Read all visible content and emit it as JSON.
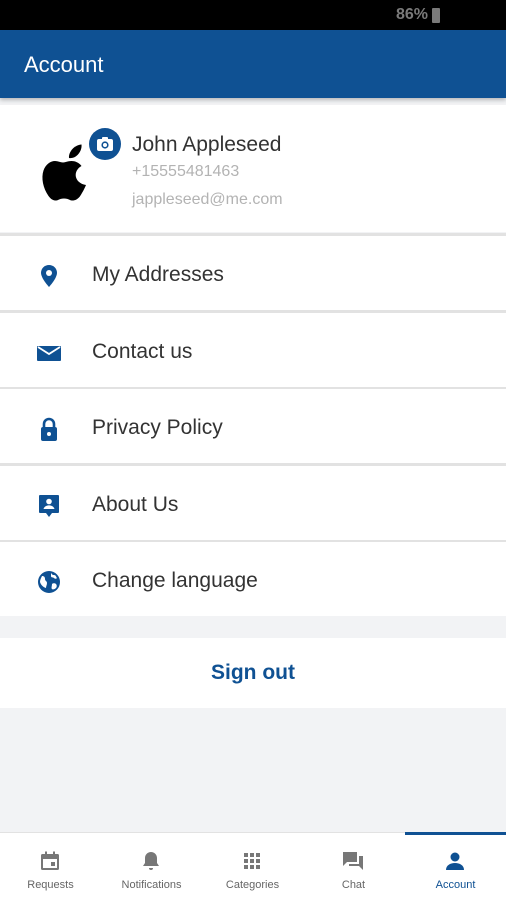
{
  "status_bar": {
    "battery": "86%"
  },
  "app_bar": {
    "title": "Account"
  },
  "profile": {
    "name": "John Appleseed",
    "phone": "+15555481463",
    "email": "jappleseed@me.com"
  },
  "menu": {
    "items": [
      {
        "label": "My Addresses",
        "icon": "location-pin-icon"
      },
      {
        "label": "Contact us",
        "icon": "mail-icon"
      },
      {
        "label": "Privacy Policy",
        "icon": "lock-icon"
      },
      {
        "label": "About Us",
        "icon": "contact-card-icon"
      },
      {
        "label": "Change language",
        "icon": "globe-icon"
      }
    ]
  },
  "sign_out": "Sign out",
  "bottom_nav": {
    "items": [
      {
        "label": "Requests",
        "icon": "calendar-icon"
      },
      {
        "label": "Notifications",
        "icon": "bell-icon"
      },
      {
        "label": "Categories",
        "icon": "grid-icon"
      },
      {
        "label": "Chat",
        "icon": "chat-icon"
      },
      {
        "label": "Account",
        "icon": "person-icon",
        "active": true
      }
    ]
  },
  "colors": {
    "primary": "#0f5193",
    "muted_text": "#b3b3b3",
    "icon_inactive": "#777777"
  }
}
